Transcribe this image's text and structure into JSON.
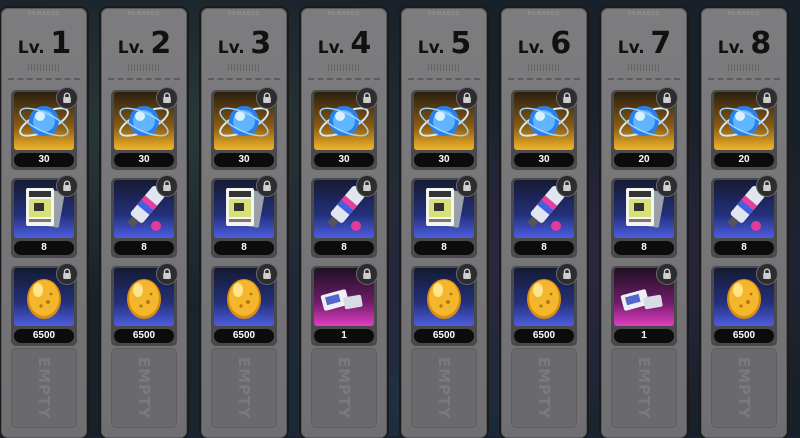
{
  "level_prefix": "Lv.",
  "empty_label": "EMPTY",
  "header_tag": "REWARDS",
  "levels": [
    {
      "num": "1",
      "slots": [
        {
          "item": "core-orb",
          "rarity": "gold",
          "count": "30"
        },
        {
          "item": "data-card",
          "rarity": "blue",
          "count": "8"
        },
        {
          "item": "gold-egg",
          "rarity": "blue",
          "count": "6500"
        }
      ]
    },
    {
      "num": "2",
      "slots": [
        {
          "item": "core-orb",
          "rarity": "gold",
          "count": "30"
        },
        {
          "item": "paint-tube",
          "rarity": "blue",
          "count": "8"
        },
        {
          "item": "gold-egg",
          "rarity": "blue",
          "count": "6500"
        }
      ]
    },
    {
      "num": "3",
      "slots": [
        {
          "item": "core-orb",
          "rarity": "gold",
          "count": "30"
        },
        {
          "item": "data-card",
          "rarity": "blue",
          "count": "8"
        },
        {
          "item": "gold-egg",
          "rarity": "blue",
          "count": "6500"
        }
      ]
    },
    {
      "num": "4",
      "slots": [
        {
          "item": "core-orb",
          "rarity": "gold",
          "count": "30"
        },
        {
          "item": "paint-tube",
          "rarity": "blue",
          "count": "8"
        },
        {
          "item": "ticket",
          "rarity": "pink",
          "count": "1"
        }
      ]
    },
    {
      "num": "5",
      "slots": [
        {
          "item": "core-orb",
          "rarity": "gold",
          "count": "30"
        },
        {
          "item": "data-card",
          "rarity": "blue",
          "count": "8"
        },
        {
          "item": "gold-egg",
          "rarity": "blue",
          "count": "6500"
        }
      ]
    },
    {
      "num": "6",
      "slots": [
        {
          "item": "core-orb",
          "rarity": "gold",
          "count": "30"
        },
        {
          "item": "paint-tube",
          "rarity": "blue",
          "count": "8"
        },
        {
          "item": "gold-egg",
          "rarity": "blue",
          "count": "6500"
        }
      ]
    },
    {
      "num": "7",
      "slots": [
        {
          "item": "core-orb",
          "rarity": "gold",
          "count": "20"
        },
        {
          "item": "data-card",
          "rarity": "blue",
          "count": "8"
        },
        {
          "item": "ticket",
          "rarity": "pink",
          "count": "1"
        }
      ]
    },
    {
      "num": "8",
      "slots": [
        {
          "item": "core-orb",
          "rarity": "gold",
          "count": "20"
        },
        {
          "item": "paint-tube",
          "rarity": "blue",
          "count": "8"
        },
        {
          "item": "gold-egg",
          "rarity": "blue",
          "count": "6500"
        }
      ]
    }
  ]
}
